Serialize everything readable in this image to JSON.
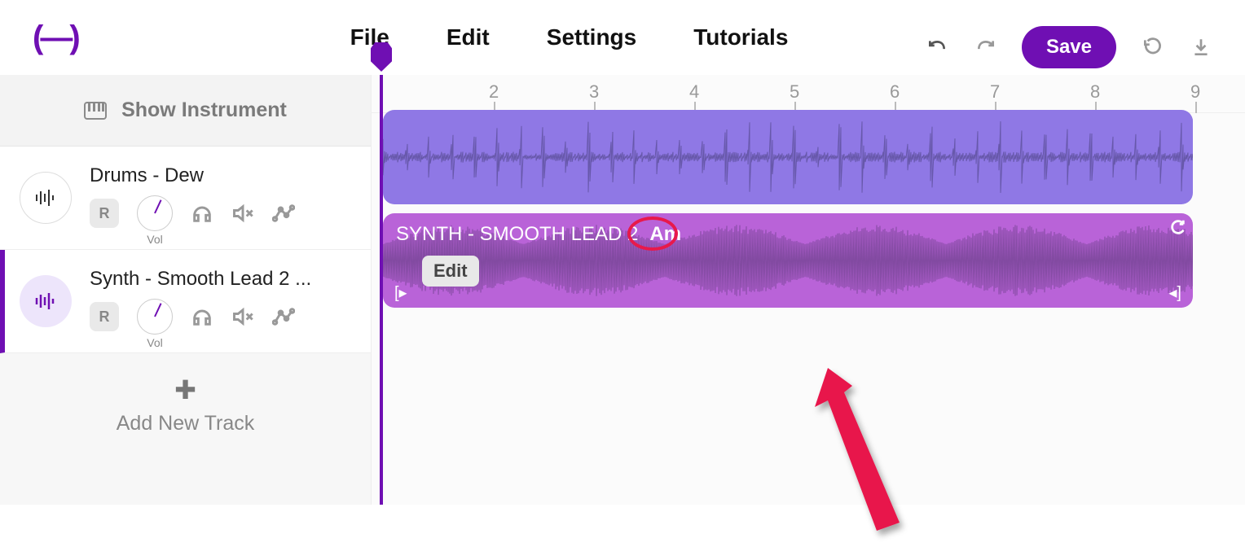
{
  "brand": "(—)",
  "menus": {
    "file": "File",
    "edit": "Edit",
    "settings": "Settings",
    "tutorials": "Tutorials"
  },
  "actions": {
    "save": "Save"
  },
  "sidebar": {
    "show_instrument": "Show Instrument",
    "tracks": [
      {
        "name": "Drums - Dew",
        "r": "R",
        "vol": "Vol"
      },
      {
        "name": "Synth - Smooth Lead 2 ...",
        "r": "R",
        "vol": "Vol"
      }
    ],
    "add_new": "Add New Track"
  },
  "timeline": {
    "ticks": [
      "2",
      "3",
      "4",
      "5",
      "6",
      "7",
      "8",
      "9"
    ]
  },
  "clips": {
    "synth": {
      "title": "SYNTH - SMOOTH LEAD 2",
      "key": "Am",
      "edit": "Edit"
    }
  },
  "annotation": {
    "circle_color": "#e8194b",
    "arrow_color": "#e8194b"
  }
}
